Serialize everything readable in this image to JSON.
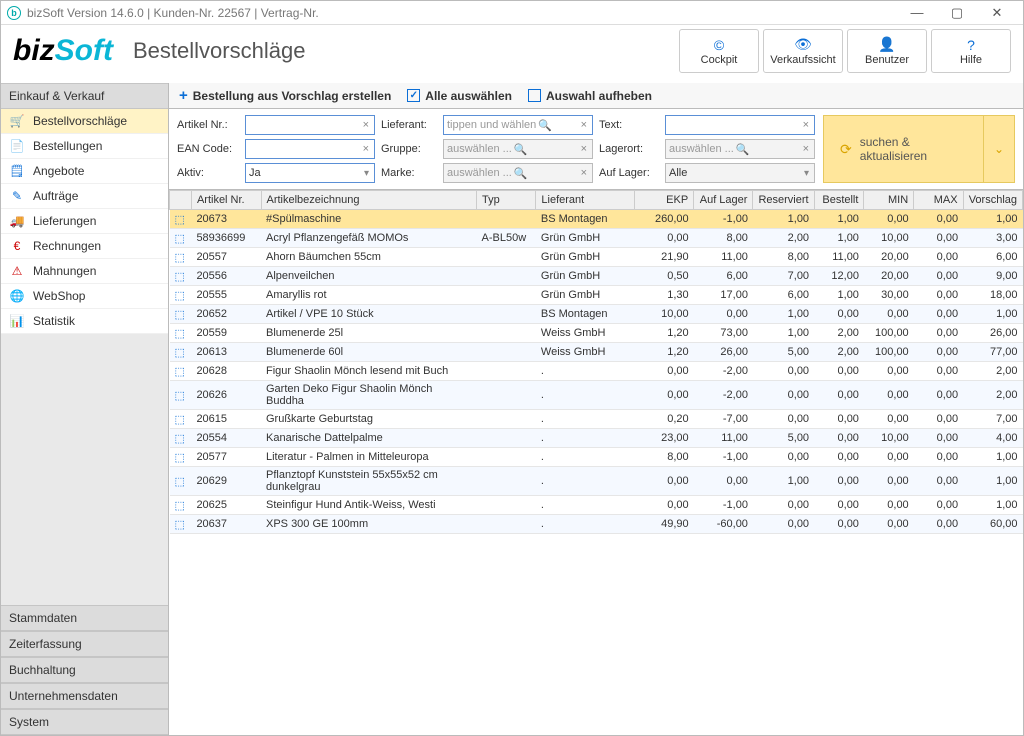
{
  "titlebar": "bizSoft Version 14.6.0 | Kunden-Nr. 22567 | Vertrag-Nr.",
  "logo": {
    "part1": "biz",
    "part2": "Soft"
  },
  "page_title": "Bestellvorschläge",
  "header_buttons": [
    {
      "icon": "©",
      "label": "Cockpit"
    },
    {
      "icon": "👁",
      "label": "Verkaufssicht"
    },
    {
      "icon": "👤",
      "label": "Benutzer"
    },
    {
      "icon": "?",
      "label": "Hilfe"
    }
  ],
  "sidebar": {
    "top_section": "Einkauf & Verkauf",
    "items": [
      {
        "icon": "🛒",
        "label": "Bestellvorschläge",
        "color": "#0b6ed6"
      },
      {
        "icon": "📄",
        "label": "Bestellungen",
        "color": "#0b6ed6"
      },
      {
        "icon": "🗒",
        "label": "Angebote",
        "color": "#0b6ed6"
      },
      {
        "icon": "✎",
        "label": "Aufträge",
        "color": "#0b6ed6"
      },
      {
        "icon": "🚚",
        "label": "Lieferungen",
        "color": "#0b6ed6"
      },
      {
        "icon": "€",
        "label": "Rechnungen",
        "color": "#c00"
      },
      {
        "icon": "⚠",
        "label": "Mahnungen",
        "color": "#c00"
      },
      {
        "icon": "🌐",
        "label": "WebShop",
        "color": "#0b6ed6"
      },
      {
        "icon": "📊",
        "label": "Statistik",
        "color": "#0b6ed6"
      }
    ],
    "bottom_sections": [
      "Stammdaten",
      "Zeiterfassung",
      "Buchhaltung",
      "Unternehmensdaten",
      "System"
    ]
  },
  "toolbar": {
    "create": "Bestellung aus Vorschlag erstellen",
    "select_all": "Alle auswählen",
    "deselect": "Auswahl aufheben"
  },
  "filters": {
    "labels": {
      "artikel": "Artikel Nr.:",
      "ean": "EAN Code:",
      "aktiv": "Aktiv:",
      "lieferant": "Lieferant:",
      "gruppe": "Gruppe:",
      "marke": "Marke:",
      "text": "Text:",
      "lagerort": "Lagerort:",
      "auflager": "Auf Lager:"
    },
    "values": {
      "aktiv": "Ja",
      "auflager": "Alle"
    },
    "placeholders": {
      "lieferant": "tippen und wählen",
      "gruppe": "auswählen ...",
      "marke": "auswählen ...",
      "lagerort": "auswählen ..."
    },
    "search_btn": "suchen & aktualisieren"
  },
  "table": {
    "headers": [
      "",
      "Artikel Nr.",
      "Artikelbezeichnung",
      "Typ",
      "Lieferant",
      "EKP",
      "Auf Lager",
      "Reserviert",
      "Bestellt",
      "MIN",
      "MAX",
      "Vorschlag"
    ],
    "rows": [
      {
        "sel": true,
        "nr": "20673",
        "bez": "#Spülmaschine",
        "typ": "",
        "lief": "BS Montagen",
        "ekp": "260,00",
        "lager": "-1,00",
        "res": "1,00",
        "best": "1,00",
        "min": "0,00",
        "max": "0,00",
        "vor": "1,00"
      },
      {
        "nr": "58936699",
        "bez": "Acryl Pflanzengefäß MOMOs",
        "typ": "A-BL50w",
        "lief": "Grün GmbH",
        "ekp": "0,00",
        "lager": "8,00",
        "res": "2,00",
        "best": "1,00",
        "min": "10,00",
        "max": "0,00",
        "vor": "3,00"
      },
      {
        "nr": "20557",
        "bez": "Ahorn Bäumchen 55cm",
        "typ": "",
        "lief": "Grün GmbH",
        "ekp": "21,90",
        "lager": "11,00",
        "res": "8,00",
        "best": "11,00",
        "min": "20,00",
        "max": "0,00",
        "vor": "6,00"
      },
      {
        "nr": "20556",
        "bez": "Alpenveilchen",
        "typ": "",
        "lief": "Grün GmbH",
        "ekp": "0,50",
        "lager": "6,00",
        "res": "7,00",
        "best": "12,00",
        "min": "20,00",
        "max": "0,00",
        "vor": "9,00"
      },
      {
        "nr": "20555",
        "bez": "Amaryllis rot",
        "typ": "",
        "lief": "Grün GmbH",
        "ekp": "1,30",
        "lager": "17,00",
        "res": "6,00",
        "best": "1,00",
        "min": "30,00",
        "max": "0,00",
        "vor": "18,00"
      },
      {
        "nr": "20652",
        "bez": "Artikel  / VPE 10 Stück",
        "typ": "",
        "lief": "BS Montagen",
        "ekp": "10,00",
        "lager": "0,00",
        "res": "1,00",
        "best": "0,00",
        "min": "0,00",
        "max": "0,00",
        "vor": "1,00"
      },
      {
        "nr": "20559",
        "bez": "Blumenerde 25l",
        "typ": "",
        "lief": "Weiss GmbH",
        "ekp": "1,20",
        "lager": "73,00",
        "res": "1,00",
        "best": "2,00",
        "min": "100,00",
        "max": "0,00",
        "vor": "26,00"
      },
      {
        "nr": "20613",
        "bez": "Blumenerde 60l",
        "typ": "",
        "lief": "Weiss GmbH",
        "ekp": "1,20",
        "lager": "26,00",
        "res": "5,00",
        "best": "2,00",
        "min": "100,00",
        "max": "0,00",
        "vor": "77,00"
      },
      {
        "nr": "20628",
        "bez": "Figur Shaolin Mönch lesend mit Buch",
        "typ": "",
        "lief": ".",
        "ekp": "0,00",
        "lager": "-2,00",
        "res": "0,00",
        "best": "0,00",
        "min": "0,00",
        "max": "0,00",
        "vor": "2,00"
      },
      {
        "nr": "20626",
        "bez": "Garten Deko Figur Shaolin Mönch Buddha",
        "typ": "",
        "lief": ".",
        "ekp": "0,00",
        "lager": "-2,00",
        "res": "0,00",
        "best": "0,00",
        "min": "0,00",
        "max": "0,00",
        "vor": "2,00"
      },
      {
        "nr": "20615",
        "bez": "Grußkarte Geburtstag",
        "typ": "",
        "lief": ".",
        "ekp": "0,20",
        "lager": "-7,00",
        "res": "0,00",
        "best": "0,00",
        "min": "0,00",
        "max": "0,00",
        "vor": "7,00"
      },
      {
        "nr": "20554",
        "bez": "Kanarische Dattelpalme",
        "typ": "",
        "lief": ".",
        "ekp": "23,00",
        "lager": "11,00",
        "res": "5,00",
        "best": "0,00",
        "min": "10,00",
        "max": "0,00",
        "vor": "4,00"
      },
      {
        "nr": "20577",
        "bez": "Literatur - Palmen in Mitteleuropa",
        "typ": "",
        "lief": ".",
        "ekp": "8,00",
        "lager": "-1,00",
        "res": "0,00",
        "best": "0,00",
        "min": "0,00",
        "max": "0,00",
        "vor": "1,00"
      },
      {
        "nr": "20629",
        "bez": "Pflanztopf Kunststein 55x55x52 cm dunkelgrau",
        "typ": "",
        "lief": ".",
        "ekp": "0,00",
        "lager": "0,00",
        "res": "1,00",
        "best": "0,00",
        "min": "0,00",
        "max": "0,00",
        "vor": "1,00"
      },
      {
        "nr": "20625",
        "bez": "Steinfigur Hund Antik-Weiss, Westi",
        "typ": "",
        "lief": ".",
        "ekp": "0,00",
        "lager": "-1,00",
        "res": "0,00",
        "best": "0,00",
        "min": "0,00",
        "max": "0,00",
        "vor": "1,00"
      },
      {
        "nr": "20637",
        "bez": "XPS 300 GE 100mm",
        "typ": "",
        "lief": ".",
        "ekp": "49,90",
        "lager": "-60,00",
        "res": "0,00",
        "best": "0,00",
        "min": "0,00",
        "max": "0,00",
        "vor": "60,00"
      }
    ]
  }
}
